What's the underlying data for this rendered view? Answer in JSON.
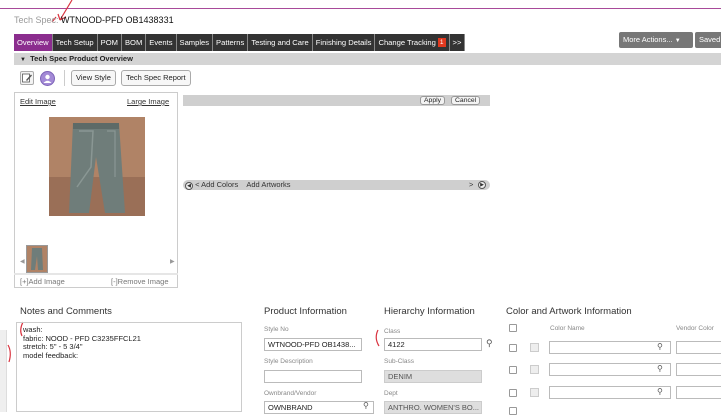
{
  "header": {
    "label": "Tech Spec:",
    "value": "WTNOOD-PFD OB1438331"
  },
  "tabs": [
    {
      "label": "Overview",
      "active": true
    },
    {
      "label": "Tech Setup"
    },
    {
      "label": "POM"
    },
    {
      "label": "BOM"
    },
    {
      "label": "Events"
    },
    {
      "label": "Samples"
    },
    {
      "label": "Patterns"
    },
    {
      "label": "Testing and Care"
    },
    {
      "label": "Finishing Details"
    },
    {
      "label": "Change Tracking",
      "badge": "1"
    },
    {
      "label": ">>"
    }
  ],
  "actions": {
    "more_actions": "More Actions...",
    "saved": "Saved"
  },
  "section": {
    "title": "Tech Spec Product Overview"
  },
  "toolbar": {
    "view_style": "View Style",
    "tech_spec_report": "Tech Spec Report"
  },
  "image_panel": {
    "edit_image": "Edit Image",
    "large_image": "Large Image",
    "add_image": "[+]Add Image",
    "remove_image": "[-]Remove Image"
  },
  "color_panel": {
    "apply": "Apply",
    "cancel": "Cancel",
    "add_colors": "< Add Colors",
    "add_artworks": "Add Artworks",
    "scroll_right": ">"
  },
  "notes": {
    "heading": "Notes and Comments",
    "lines": [
      "wash:",
      "fabric: NOOD - PFD C3235FFCL21",
      "stretch: 5\" - 5 3/4\"",
      "model feedback:"
    ]
  },
  "product_info": {
    "heading": "Product Information",
    "style_no_label": "Style No",
    "style_no_value": "WTNOOD-PFD OB1438...",
    "style_desc_label": "Style Description",
    "style_desc_value": "",
    "ownbrand_label": "Ownbrand/Vendor",
    "ownbrand_value": "OWNBRAND"
  },
  "hierarchy_info": {
    "heading": "Hierarchy Information",
    "class_label": "Class",
    "class_value": "4122",
    "subclass_label": "Sub-Class",
    "subclass_value": "DENIM",
    "dept_label": "Dept",
    "dept_value": "ANTHRO. WOMEN'S BO..."
  },
  "color_artwork": {
    "heading": "Color and Artwork Information",
    "col_color_name": "Color Name",
    "col_vendor_color": "Vendor Color"
  },
  "colors": {
    "accent": "#8b2d8e",
    "tabbar": "#333333",
    "badge": "#e2391f",
    "annotation": "#d9333f"
  }
}
